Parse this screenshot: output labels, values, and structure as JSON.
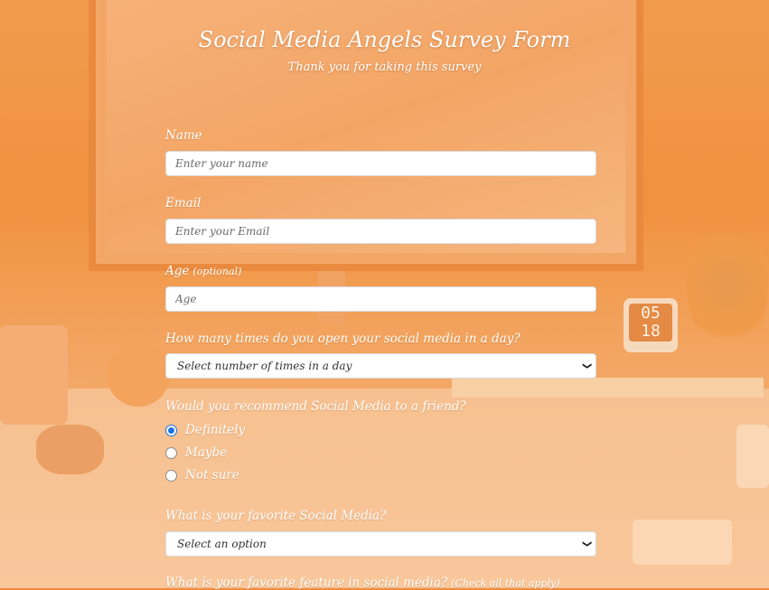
{
  "header": {
    "title": "Social Media Angels Survey Form",
    "subtitle": "Thank you for taking this survey"
  },
  "form": {
    "name": {
      "label": "Name",
      "placeholder": "Enter your name",
      "value": ""
    },
    "email": {
      "label": "Email",
      "placeholder": "Enter your Email",
      "value": ""
    },
    "age": {
      "label": "Age",
      "note": "(optional)",
      "placeholder": "Age",
      "value": ""
    },
    "frequency": {
      "label": "How many times do you open your social media in a day?",
      "selected": "Select number of times in a day"
    },
    "recommend": {
      "label": "Would you recommend Social Media to a friend?",
      "options": [
        "Definitely",
        "Maybe",
        "Not sure"
      ],
      "selected": "Definitely"
    },
    "favorite": {
      "label": "What is your favorite Social Media?",
      "selected": "Select an option"
    },
    "feature": {
      "label": "What is your favorite feature in social media?",
      "note": "(Check all that apply)"
    }
  },
  "colors": {
    "accent_overlay": "#f08a3e",
    "radio_checked": "#1a73e8"
  },
  "background": {
    "clock_display": [
      "05",
      "18"
    ]
  }
}
